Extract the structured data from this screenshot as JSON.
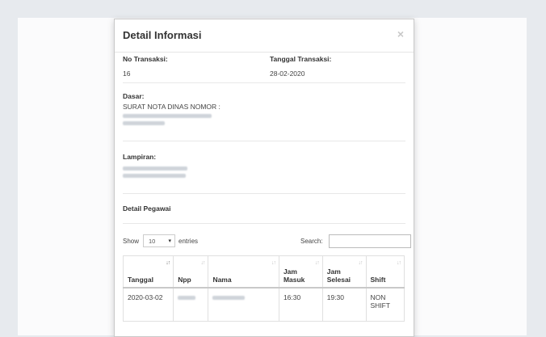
{
  "modal": {
    "title": "Detail Informasi",
    "close_glyph": "×",
    "no_transaksi_label": "No Transaksi:",
    "no_transaksi_value": "16",
    "tanggal_label": "Tanggal Transaksi:",
    "tanggal_value": "28-02-2020",
    "dasar_label": "Dasar:",
    "dasar_text": "SURAT NOTA DINAS NOMOR :",
    "lampiran_label": "Lampiran:",
    "detail_pegawai_label": "Detail Pegawai"
  },
  "table_controls": {
    "show_label": "Show",
    "entries_value": "10",
    "entries_label": "entries",
    "search_label": "Search:",
    "search_value": ""
  },
  "table": {
    "columns": [
      "Tanggal",
      "Npp",
      "Nama",
      "Jam Masuk",
      "Jam Selesai",
      "Shift"
    ],
    "sort_glyph": "↓↑",
    "rows": [
      {
        "tanggal": "2020-03-02",
        "jam_masuk": "16:30",
        "jam_selesai": "19:30",
        "shift": "NON SHIFT"
      }
    ]
  },
  "icons": {
    "close": "close-icon",
    "caret": "chevron-down-icon",
    "sort": "sort-icon"
  },
  "colors": {
    "backdrop": "#e7eaee",
    "modal_bg": "#ffffff",
    "close": "#c8c8c8"
  }
}
